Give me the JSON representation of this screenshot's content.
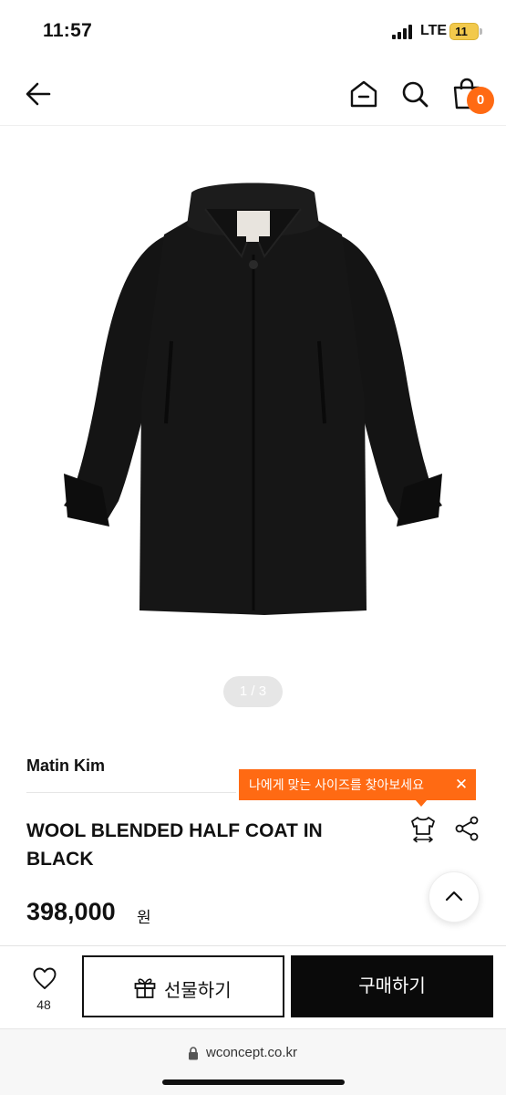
{
  "status_bar": {
    "time": "11:57",
    "network": "LTE",
    "battery": "11"
  },
  "header": {
    "back": "back-arrow",
    "icons": [
      "home-icon",
      "search-icon",
      "shopping-bag-icon"
    ],
    "cart_count": "0"
  },
  "product": {
    "pager": "1 / 3",
    "brand": "Matin Kim",
    "name": "WOOL BLENDED HALF COAT IN BLACK",
    "price": "398,000",
    "price_unit": "원",
    "size_tooltip": "나에게 맞는 사이즈를 찾아보세요",
    "tooltip_close": "✕"
  },
  "bottom_bar": {
    "likes": "48",
    "gift_label": "선물하기",
    "buy_label": "구매하기"
  },
  "browser": {
    "url": "wconcept.co.kr"
  },
  "colors": {
    "accent": "#ff6a13",
    "buy_button": "#0a0a0a"
  }
}
